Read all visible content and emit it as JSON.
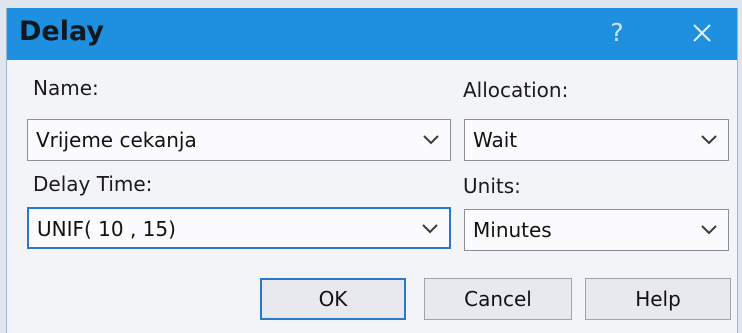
{
  "window": {
    "title": "Delay",
    "help_glyph": "?"
  },
  "fields": {
    "name_label": "Name:",
    "name_value": "Vrijeme cekanja",
    "delay_time_label": "Delay Time:",
    "delay_time_value": "UNIF( 10 , 15)",
    "allocation_label": "Allocation:",
    "allocation_value": "Wait",
    "units_label": "Units:",
    "units_value": "Minutes"
  },
  "buttons": {
    "ok": "OK",
    "cancel": "Cancel",
    "help": "Help"
  },
  "colors": {
    "titlebar": "#1f8fe0",
    "focus": "#2a78c8",
    "background": "#f3f4f8"
  },
  "icons": [
    "help-icon",
    "close-icon",
    "chevron-down-icon"
  ]
}
